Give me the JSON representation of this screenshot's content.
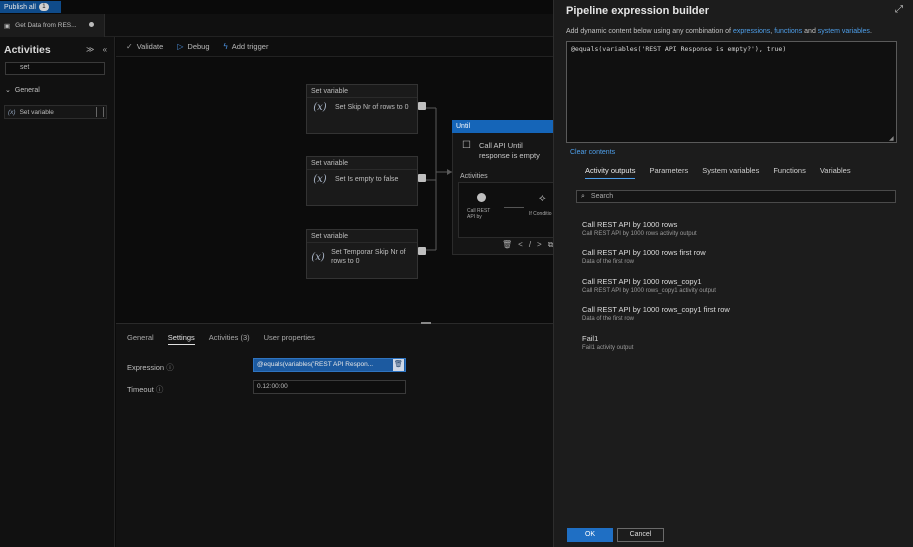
{
  "topbar": {
    "publish_label": "Publish all",
    "publish_count": "1"
  },
  "tab": {
    "title": "Get Data from RES..."
  },
  "left": {
    "title": "Activities",
    "collapse_icons": "≫ «",
    "search_value": "set",
    "group": "General",
    "item": "Set variable"
  },
  "toolbar": {
    "validate": "Validate",
    "debug": "Debug",
    "add_trigger": "Add trigger"
  },
  "canvas": {
    "cards": [
      {
        "head": "Set variable",
        "body": "Set Skip Nr of rows to 0"
      },
      {
        "head": "Set variable",
        "body": "Set Is empty to false"
      },
      {
        "head": "Set variable",
        "body": "Set Temporar Skip Nr of rows to 0"
      }
    ],
    "until": {
      "head": "Until",
      "desc": "Call API Until response is empty",
      "activities_label": "Activities",
      "inner_a": "Call REST API by",
      "inner_b": "If Conditio"
    }
  },
  "bottom": {
    "tabs": [
      "General",
      "Settings",
      "Activities (3)",
      "User properties"
    ],
    "active_tab": "Settings",
    "expression_label": "Expression",
    "expression_value": "@equals(variables('REST API Respon...",
    "timeout_label": "Timeout",
    "timeout_value": "0.12:00:00"
  },
  "pane": {
    "title": "Pipeline expression builder",
    "hint_prefix": "Add dynamic content below using any combination of ",
    "hint_link1": "expressions",
    "hint_sep": ", ",
    "hint_link2": "functions",
    "hint_and": " and ",
    "hint_link3": "system variables",
    "hint_end": ".",
    "editor_value": "@equals(variables('REST API Response is empty?'), true)",
    "clear": "Clear contents",
    "tabs": [
      "Activity outputs",
      "Parameters",
      "System variables",
      "Functions",
      "Variables"
    ],
    "active_tab": "Activity outputs",
    "search_placeholder": "Search",
    "outputs": [
      {
        "title": "Call REST API by 1000 rows",
        "sub": "Call REST API by 1000 rows activity output"
      },
      {
        "title": "Call REST API by 1000 rows first row",
        "sub": "Data of the first row"
      },
      {
        "title": "Call REST API by 1000 rows_copy1",
        "sub": "Call REST API by 1000 rows_copy1 activity output"
      },
      {
        "title": "Call REST API by 1000 rows_copy1 first row",
        "sub": "Data of the first row"
      },
      {
        "title": "Fail1",
        "sub": "Fail1 activity output"
      }
    ],
    "ok": "OK",
    "cancel": "Cancel"
  }
}
